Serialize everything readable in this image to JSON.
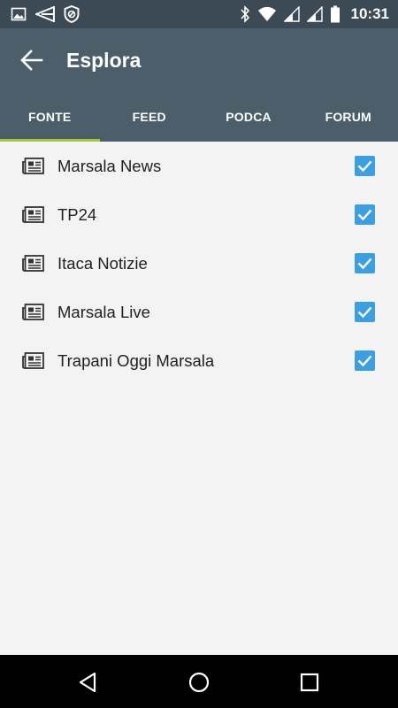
{
  "status_bar": {
    "time": "10:31",
    "left_icons": [
      "image-icon",
      "send-icon",
      "shield-block-icon"
    ],
    "right_icons": [
      "bluetooth-icon",
      "wifi-icon",
      "signal-icon",
      "signal-icon",
      "battery-icon"
    ]
  },
  "app_bar": {
    "title": "Esplora",
    "back_icon": "arrow-back-icon"
  },
  "tabs": [
    {
      "label": "FONTE",
      "selected": true
    },
    {
      "label": "FEED",
      "selected": false
    },
    {
      "label": "PODCAST",
      "selected": false
    },
    {
      "label": "FORUM",
      "selected": false
    }
  ],
  "sources": [
    {
      "name": "Marsala News",
      "checked": true
    },
    {
      "name": "TP24",
      "checked": true
    },
    {
      "name": "Itaca Notizie",
      "checked": true
    },
    {
      "name": "Marsala Live",
      "checked": true
    },
    {
      "name": "Trapani Oggi Marsala",
      "checked": true
    }
  ],
  "nav_bar": [
    "back-triangle-icon",
    "home-circle-icon",
    "recents-square-icon"
  ],
  "colors": {
    "status_bar": "#3b4a55",
    "app_bar": "#4b5e6a",
    "tab_indicator": "#a4c639",
    "checkbox": "#3d9fe0",
    "background": "#f3f3f3"
  }
}
